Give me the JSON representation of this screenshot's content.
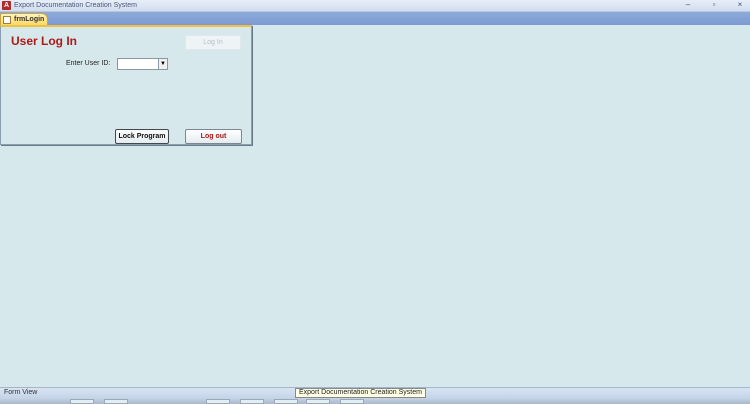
{
  "window": {
    "title": "Export Documentation Creation System",
    "app_icon": "access-icon",
    "minimize": "–",
    "maximize": "▫",
    "close": "×"
  },
  "tab": {
    "label": "frmLogin",
    "icon": "form-icon"
  },
  "form": {
    "title": "User Log In",
    "login_button": "Log In",
    "userid_label": "Enter User ID:",
    "userid_value": "",
    "combo_arrow": "▼",
    "lock_button": "Lock Program",
    "logout_button": "Log out"
  },
  "status": {
    "view": "Form View",
    "tooltip": "Export Documentation Creation System"
  },
  "colors": {
    "background": "#d6e8ec",
    "title_red": "#b01818",
    "tab_gold": "#ffd867"
  }
}
